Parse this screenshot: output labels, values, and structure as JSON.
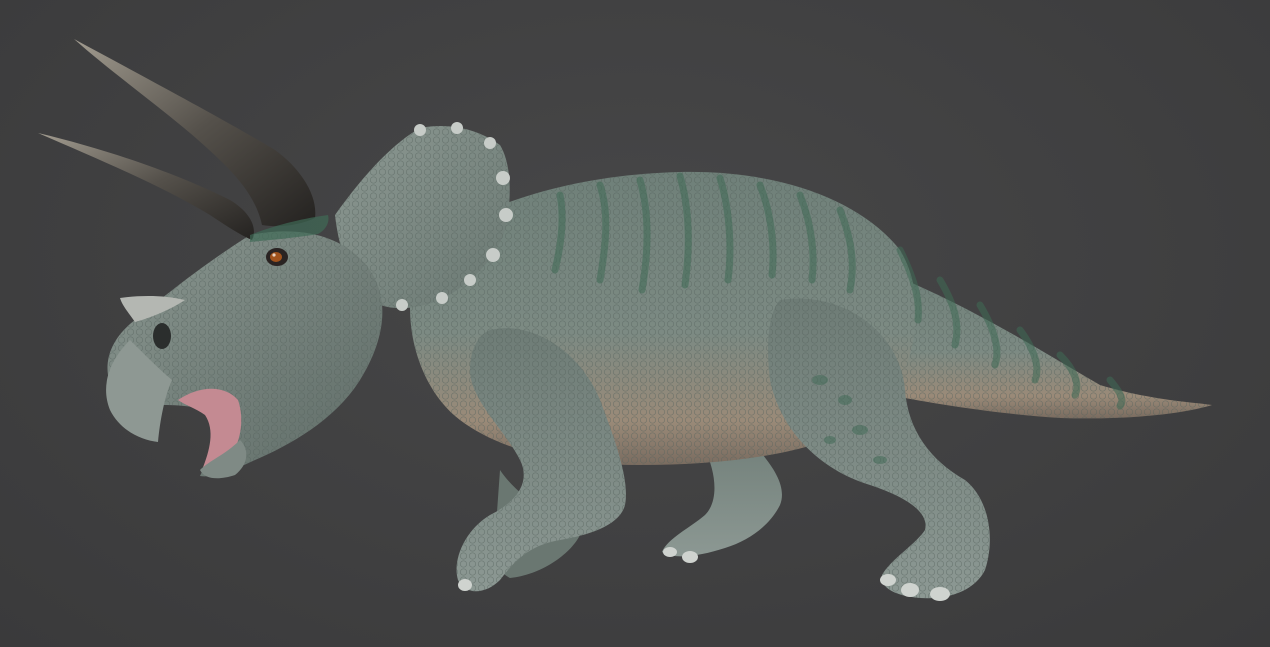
{
  "scene": {
    "subject_icon": "triceratops-model",
    "colors": {
      "background": "#404041",
      "skin": "#7a8781",
      "skin_shadow": "#4f5a56",
      "belly": "#a08b77",
      "stripes": "#3f6a55",
      "horn_base": "#2a2826",
      "horn_tip": "#8d877c",
      "eye": "#a0521c",
      "mouth": "#c48a92"
    }
  }
}
